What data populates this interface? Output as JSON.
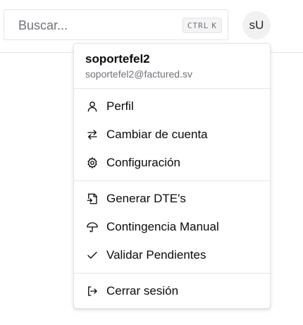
{
  "search": {
    "placeholder": "Buscar...",
    "shortcut_key1": "CTRL",
    "shortcut_key2": "K"
  },
  "avatar": {
    "initials": "sU"
  },
  "user_menu": {
    "name": "soportefel2",
    "email": "soportefel2@factured.sv",
    "account_items": [
      {
        "label": "Perfil",
        "icon": "user-icon"
      },
      {
        "label": "Cambiar de cuenta",
        "icon": "arrows-swap-icon"
      },
      {
        "label": "Configuración",
        "icon": "gear-icon"
      }
    ],
    "action_items": [
      {
        "label": "Generar DTE's",
        "icon": "file-input-icon"
      },
      {
        "label": "Contingencia Manual",
        "icon": "umbrella-icon"
      },
      {
        "label": "Validar Pendientes",
        "icon": "check-icon"
      }
    ],
    "logout_item": {
      "label": "Cerrar sesión",
      "icon": "logout-icon"
    }
  }
}
